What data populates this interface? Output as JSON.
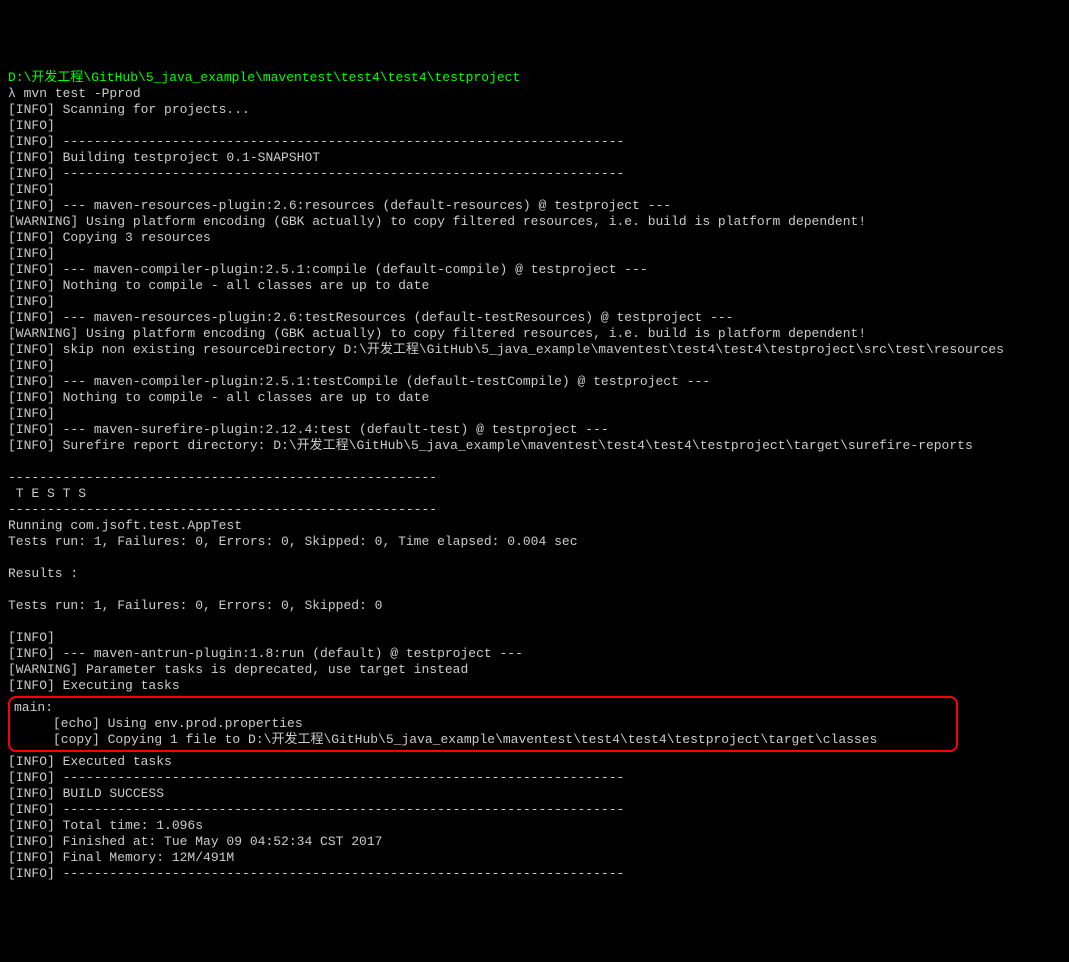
{
  "terminal": {
    "cwd": "D:\\开发工程\\GitHub\\5_java_example\\maventest\\test4\\test4\\testproject",
    "prompt_symbol": "λ ",
    "command": "mvn test -Pprod",
    "lines": [
      "[INFO] Scanning for projects...",
      "[INFO]",
      "[INFO] ------------------------------------------------------------------------",
      "[INFO] Building testproject 0.1-SNAPSHOT",
      "[INFO] ------------------------------------------------------------------------",
      "[INFO]",
      "[INFO] --- maven-resources-plugin:2.6:resources (default-resources) @ testproject ---",
      "[WARNING] Using platform encoding (GBK actually) to copy filtered resources, i.e. build is platform dependent!",
      "[INFO] Copying 3 resources",
      "[INFO]",
      "[INFO] --- maven-compiler-plugin:2.5.1:compile (default-compile) @ testproject ---",
      "[INFO] Nothing to compile - all classes are up to date",
      "[INFO]",
      "[INFO] --- maven-resources-plugin:2.6:testResources (default-testResources) @ testproject ---",
      "[WARNING] Using platform encoding (GBK actually) to copy filtered resources, i.e. build is platform dependent!",
      "[INFO] skip non existing resourceDirectory D:\\开发工程\\GitHub\\5_java_example\\maventest\\test4\\test4\\testproject\\src\\test\\resources",
      "[INFO]",
      "[INFO] --- maven-compiler-plugin:2.5.1:testCompile (default-testCompile) @ testproject ---",
      "[INFO] Nothing to compile - all classes are up to date",
      "[INFO]",
      "[INFO] --- maven-surefire-plugin:2.12.4:test (default-test) @ testproject ---",
      "[INFO] Surefire report directory: D:\\开发工程\\GitHub\\5_java_example\\maventest\\test4\\test4\\testproject\\target\\surefire-reports",
      "",
      "-------------------------------------------------------",
      " T E S T S",
      "-------------------------------------------------------",
      "Running com.jsoft.test.AppTest",
      "Tests run: 1, Failures: 0, Errors: 0, Skipped: 0, Time elapsed: 0.004 sec",
      "",
      "Results :",
      "",
      "Tests run: 1, Failures: 0, Errors: 0, Skipped: 0",
      "",
      "[INFO]",
      "[INFO] --- maven-antrun-plugin:1.8:run (default) @ testproject ---",
      "[WARNING] Parameter tasks is deprecated, use target instead",
      "[INFO] Executing tasks",
      ""
    ],
    "highlighted": [
      "main:",
      "     [echo] Using env.prod.properties",
      "     [copy] Copying 1 file to D:\\开发工程\\GitHub\\5_java_example\\maventest\\test4\\test4\\testproject\\target\\classes"
    ],
    "lines_after": [
      "[INFO] Executed tasks",
      "[INFO] ------------------------------------------------------------------------",
      "[INFO] BUILD SUCCESS",
      "[INFO] ------------------------------------------------------------------------",
      "[INFO] Total time: 1.096s",
      "[INFO] Finished at: Tue May 09 04:52:34 CST 2017",
      "[INFO] Final Memory: 12M/491M",
      "[INFO] ------------------------------------------------------------------------"
    ]
  }
}
